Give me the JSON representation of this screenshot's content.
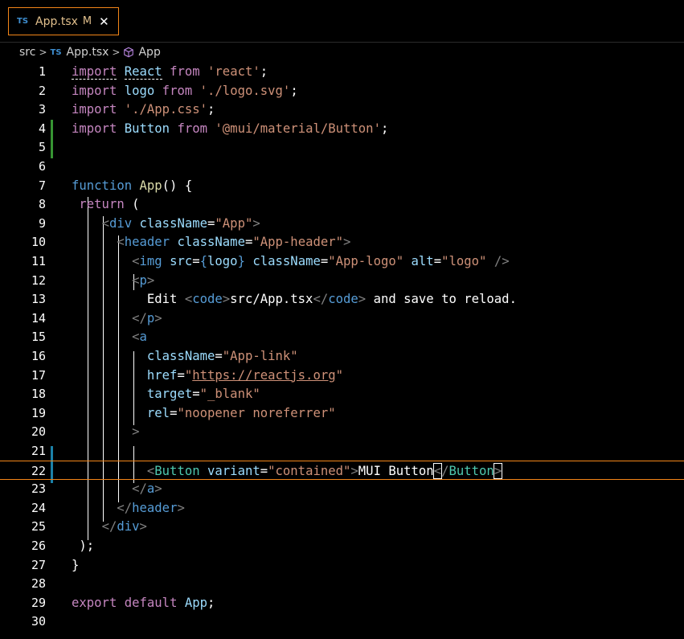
{
  "tab": {
    "badge": "TS",
    "name": "App.tsx",
    "modified": "M",
    "close": "✕"
  },
  "breadcrumb": {
    "folder": "src",
    "file_badge": "TS",
    "file": "App.tsx",
    "symbol": "App"
  },
  "current_line": 22,
  "lines": [
    {
      "n": "1",
      "tokens": [
        [
          "ctl dash",
          "import"
        ],
        [
          "",
          "·"
        ],
        [
          "var dash",
          "React"
        ],
        [
          "",
          ""
        ],
        [
          "ctl",
          " from "
        ],
        [
          "str",
          "'react'"
        ],
        [
          "",
          ";"
        ]
      ]
    },
    {
      "n": "2",
      "tokens": [
        [
          "ctl",
          "import"
        ],
        [
          "",
          " "
        ],
        [
          "var",
          "logo"
        ],
        [
          "ctl",
          " from "
        ],
        [
          "str",
          "'./logo.svg'"
        ],
        [
          "",
          ";"
        ]
      ]
    },
    {
      "n": "3",
      "tokens": [
        [
          "ctl",
          "import"
        ],
        [
          "",
          " "
        ],
        [
          "str",
          "'./App.css'"
        ],
        [
          "",
          ";"
        ]
      ]
    },
    {
      "n": "4",
      "tokens": [
        [
          "ctl",
          "import"
        ],
        [
          "",
          " "
        ],
        [
          "var",
          "Button"
        ],
        [
          "ctl",
          " from "
        ],
        [
          "str",
          "'@mui/material/Button'"
        ],
        [
          "",
          ";"
        ]
      ]
    },
    {
      "n": "5",
      "tokens": []
    },
    {
      "n": "6",
      "tokens": []
    },
    {
      "n": "7",
      "tokens": [
        [
          "kw",
          "function"
        ],
        [
          "",
          " "
        ],
        [
          "fn",
          "App"
        ],
        [
          "",
          "() {"
        ]
      ]
    },
    {
      "n": "8",
      "tokens": [
        [
          "",
          " "
        ],
        [
          "ctl",
          "return"
        ],
        [
          "",
          " ("
        ]
      ]
    },
    {
      "n": "9",
      "tokens": [
        [
          "",
          "    "
        ],
        [
          "punc",
          "<"
        ],
        [
          "tag",
          "div"
        ],
        [
          "",
          " "
        ],
        [
          "attr",
          "className"
        ],
        [
          "",
          "="
        ],
        [
          "str",
          "\"App\""
        ],
        [
          "punc",
          ">"
        ]
      ]
    },
    {
      "n": "10",
      "tokens": [
        [
          "",
          "      "
        ],
        [
          "punc",
          "<"
        ],
        [
          "tag",
          "header"
        ],
        [
          "",
          " "
        ],
        [
          "attr",
          "className"
        ],
        [
          "",
          "="
        ],
        [
          "str",
          "\"App-header\""
        ],
        [
          "punc",
          ">"
        ]
      ]
    },
    {
      "n": "11",
      "tokens": [
        [
          "",
          "        "
        ],
        [
          "punc",
          "<"
        ],
        [
          "tag",
          "img"
        ],
        [
          "",
          " "
        ],
        [
          "attr",
          "src"
        ],
        [
          "",
          "="
        ],
        [
          "kw",
          "{"
        ],
        [
          "var",
          "logo"
        ],
        [
          "kw",
          "}"
        ],
        [
          "",
          " "
        ],
        [
          "attr",
          "className"
        ],
        [
          "",
          "="
        ],
        [
          "str",
          "\"App-logo\""
        ],
        [
          "",
          " "
        ],
        [
          "attr",
          "alt"
        ],
        [
          "",
          "="
        ],
        [
          "str",
          "\"logo\""
        ],
        [
          "",
          " "
        ],
        [
          "punc",
          "/>"
        ]
      ]
    },
    {
      "n": "12",
      "tokens": [
        [
          "",
          "        "
        ],
        [
          "punc",
          "<"
        ],
        [
          "tag",
          "p"
        ],
        [
          "punc",
          ">"
        ]
      ]
    },
    {
      "n": "13",
      "tokens": [
        [
          "",
          "          Edit "
        ],
        [
          "punc",
          "<"
        ],
        [
          "tag",
          "code"
        ],
        [
          "punc",
          ">"
        ],
        [
          "",
          "src/App.tsx"
        ],
        [
          "punc",
          "</"
        ],
        [
          "tag",
          "code"
        ],
        [
          "punc",
          ">"
        ],
        [
          "",
          " and save to reload."
        ]
      ]
    },
    {
      "n": "14",
      "tokens": [
        [
          "",
          "        "
        ],
        [
          "punc",
          "</"
        ],
        [
          "tag",
          "p"
        ],
        [
          "punc",
          ">"
        ]
      ]
    },
    {
      "n": "15",
      "tokens": [
        [
          "",
          "        "
        ],
        [
          "punc",
          "<"
        ],
        [
          "tag",
          "a"
        ]
      ]
    },
    {
      "n": "16",
      "tokens": [
        [
          "",
          "          "
        ],
        [
          "attr",
          "className"
        ],
        [
          "",
          "="
        ],
        [
          "str",
          "\"App-link\""
        ]
      ]
    },
    {
      "n": "17",
      "tokens": [
        [
          "",
          "          "
        ],
        [
          "attr",
          "href"
        ],
        [
          "",
          "="
        ],
        [
          "str",
          "\""
        ],
        [
          "str ul",
          "https://reactjs.org"
        ],
        [
          "str",
          "\""
        ]
      ]
    },
    {
      "n": "18",
      "tokens": [
        [
          "",
          "          "
        ],
        [
          "attr",
          "target"
        ],
        [
          "",
          "="
        ],
        [
          "str",
          "\"_blank\""
        ]
      ]
    },
    {
      "n": "19",
      "tokens": [
        [
          "",
          "          "
        ],
        [
          "attr",
          "rel"
        ],
        [
          "",
          "="
        ],
        [
          "str",
          "\"noopener noreferrer\""
        ]
      ]
    },
    {
      "n": "20",
      "tokens": [
        [
          "",
          "        "
        ],
        [
          "punc",
          ">"
        ]
      ]
    },
    {
      "n": "21",
      "tokens": []
    },
    {
      "n": "22",
      "tokens": [
        [
          "",
          "          "
        ],
        [
          "punc",
          "<"
        ],
        [
          "cmp",
          "Button"
        ],
        [
          "",
          " "
        ],
        [
          "attr",
          "variant"
        ],
        [
          "",
          "="
        ],
        [
          "str",
          "\"contained\""
        ],
        [
          "punc",
          ">"
        ],
        [
          "",
          "MUI Button"
        ],
        [
          "punc cursorbox",
          "<"
        ],
        [
          "punc",
          "/"
        ],
        [
          "cmp",
          "Button"
        ],
        [
          "punc cursorbox",
          ">"
        ]
      ]
    },
    {
      "n": "23",
      "tokens": [
        [
          "",
          "        "
        ],
        [
          "punc",
          "</"
        ],
        [
          "tag",
          "a"
        ],
        [
          "punc",
          ">"
        ]
      ]
    },
    {
      "n": "24",
      "tokens": [
        [
          "",
          "      "
        ],
        [
          "punc",
          "</"
        ],
        [
          "tag",
          "header"
        ],
        [
          "punc",
          ">"
        ]
      ]
    },
    {
      "n": "25",
      "tokens": [
        [
          "",
          "    "
        ],
        [
          "punc",
          "</"
        ],
        [
          "tag",
          "div"
        ],
        [
          "punc",
          ">"
        ]
      ]
    },
    {
      "n": "26",
      "tokens": [
        [
          "",
          " );"
        ]
      ]
    },
    {
      "n": "27",
      "tokens": [
        [
          "",
          "}"
        ]
      ]
    },
    {
      "n": "28",
      "tokens": []
    },
    {
      "n": "29",
      "tokens": [
        [
          "ctl",
          "export"
        ],
        [
          "",
          " "
        ],
        [
          "ctl",
          "default"
        ],
        [
          "",
          " "
        ],
        [
          "var",
          "App"
        ],
        [
          "",
          ";"
        ]
      ]
    },
    {
      "n": "30",
      "tokens": []
    }
  ]
}
